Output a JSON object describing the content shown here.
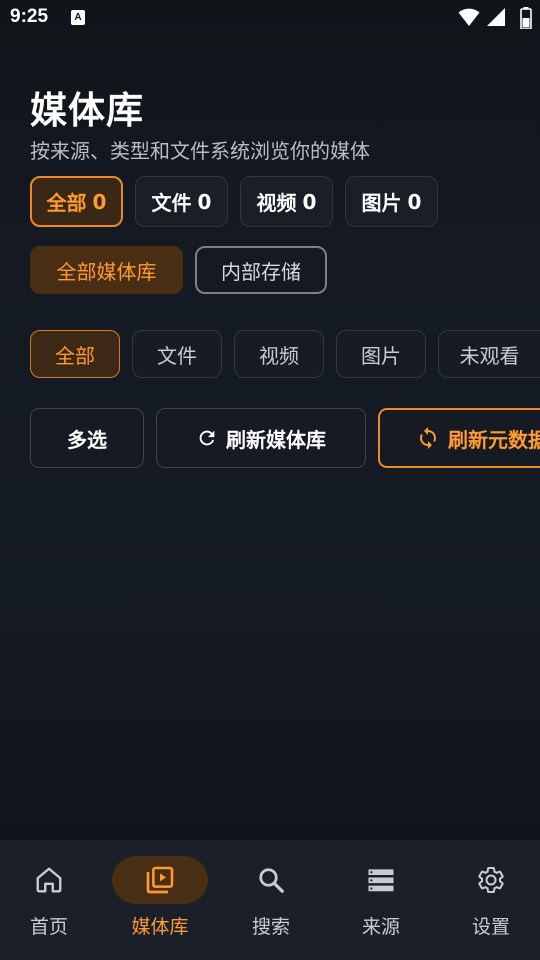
{
  "status_bar": {
    "time": "9:25",
    "app_icon_letter": "A",
    "icons": [
      "wifi-icon",
      "signal-icon",
      "battery-icon"
    ]
  },
  "header": {
    "title": "媒体库",
    "subtitle": "按来源、类型和文件系统浏览你的媒体"
  },
  "count_filters": [
    {
      "label": "全部",
      "count": "0",
      "active": true
    },
    {
      "label": "文件",
      "count": "0",
      "active": false
    },
    {
      "label": "视频",
      "count": "0",
      "active": false
    },
    {
      "label": "图片",
      "count": "0",
      "active": false
    }
  ],
  "library_filters": [
    {
      "label": "全部媒体库",
      "active": true
    },
    {
      "label": "内部存储",
      "active": false
    }
  ],
  "type_filters": [
    {
      "label": "全部",
      "active": true
    },
    {
      "label": "文件",
      "active": false
    },
    {
      "label": "视频",
      "active": false
    },
    {
      "label": "图片",
      "active": false
    },
    {
      "label": "未观看",
      "active": false
    }
  ],
  "actions": {
    "multi_select": "多选",
    "refresh_library": "刷新媒体库",
    "refresh_metadata": "刷新元数据"
  },
  "bottom_nav": [
    {
      "label": "首页",
      "icon": "home-icon",
      "active": false
    },
    {
      "label": "媒体库",
      "icon": "video-library-icon",
      "active": true
    },
    {
      "label": "搜索",
      "icon": "search-icon",
      "active": false
    },
    {
      "label": "来源",
      "icon": "storage-icon",
      "active": false
    },
    {
      "label": "设置",
      "icon": "gear-icon",
      "active": false
    }
  ],
  "colors": {
    "accent": "#ff9a30",
    "accent_bg": "#4a2e14",
    "background": "#141922"
  }
}
